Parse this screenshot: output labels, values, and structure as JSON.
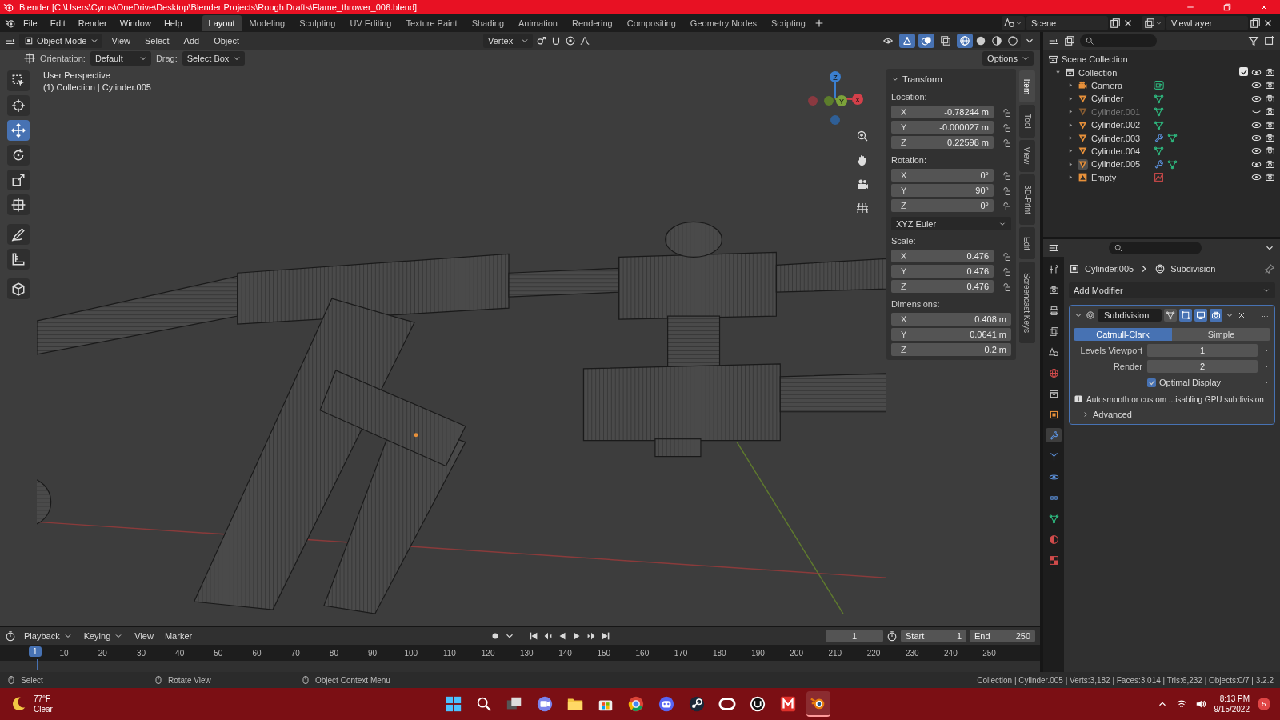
{
  "window": {
    "title": "Blender [C:\\Users\\Cyrus\\OneDrive\\Desktop\\Blender Projects\\Rough Drafts\\Flame_thrower_006.blend]"
  },
  "menu": [
    "File",
    "Edit",
    "Render",
    "Window",
    "Help"
  ],
  "workspaces": [
    {
      "label": "Layout",
      "selected": true
    },
    {
      "label": "Modeling",
      "selected": false
    },
    {
      "label": "Sculpting",
      "selected": false
    },
    {
      "label": "UV Editing",
      "selected": false
    },
    {
      "label": "Texture Paint",
      "selected": false
    },
    {
      "label": "Shading",
      "selected": false
    },
    {
      "label": "Animation",
      "selected": false
    },
    {
      "label": "Rendering",
      "selected": false
    },
    {
      "label": "Compositing",
      "selected": false
    },
    {
      "label": "Geometry Nodes",
      "selected": false
    },
    {
      "label": "Scripting",
      "selected": false
    }
  ],
  "scene": "Scene",
  "view_layer": "ViewLayer",
  "viewport_header": {
    "mode": "Object Mode",
    "menus": [
      "View",
      "Select",
      "Add",
      "Object"
    ],
    "snap_target": "Vertex",
    "toggles": [
      {
        "kind": "visibility",
        "on": false
      },
      {
        "kind": "gizmo",
        "on": true
      },
      {
        "kind": "overlays",
        "on": true
      },
      {
        "kind": "xray",
        "on": false
      }
    ],
    "shading": [
      {
        "kind": "wireframe",
        "selected": true
      },
      {
        "kind": "solid",
        "selected": false
      },
      {
        "kind": "material",
        "selected": false
      },
      {
        "kind": "rendered",
        "selected": false
      }
    ]
  },
  "tool_settings": {
    "orientation_label": "Orientation:",
    "orientation": "Default",
    "drag_label": "Drag:",
    "drag": "Select Box",
    "options": "Options"
  },
  "tools": [
    {
      "kind": "select",
      "selected": false
    },
    {
      "kind": "cursor",
      "selected": false
    },
    {
      "kind": "move",
      "selected": true
    },
    {
      "kind": "rotate",
      "selected": false
    },
    {
      "kind": "scale",
      "selected": false
    },
    {
      "kind": "transform",
      "selected": false
    },
    {
      "kind": "annotate",
      "selected": false
    },
    {
      "kind": "measure",
      "selected": false
    },
    {
      "kind": "add-cube",
      "selected": false
    }
  ],
  "viewport": {
    "view_name": "User Perspective",
    "context": "(1) Collection | Cylinder.005",
    "gizmo_axes": [
      "Z",
      "X",
      "Y"
    ]
  },
  "n_panel": {
    "title": "Transform",
    "groups": [
      {
        "label": "Location:",
        "kind": "lockable",
        "fields": [
          {
            "axis": "X",
            "value": "-0.78244 m"
          },
          {
            "axis": "Y",
            "value": "-0.000027 m"
          },
          {
            "axis": "Z",
            "value": "0.22598 m"
          }
        ]
      },
      {
        "label": "Rotation:",
        "kind": "lockable",
        "fields": [
          {
            "axis": "X",
            "value": "0°"
          },
          {
            "axis": "Y",
            "value": "90°"
          },
          {
            "axis": "Z",
            "value": "0°"
          }
        ],
        "mode": "XYZ Euler"
      },
      {
        "label": "Scale:",
        "kind": "lockable",
        "fields": [
          {
            "axis": "X",
            "value": "0.476"
          },
          {
            "axis": "Y",
            "value": "0.476"
          },
          {
            "axis": "Z",
            "value": "0.476"
          }
        ]
      },
      {
        "label": "Dimensions:",
        "kind": "plain",
        "fields": [
          {
            "axis": "X",
            "value": "0.408 m"
          },
          {
            "axis": "Y",
            "value": "0.0641 m"
          },
          {
            "axis": "Z",
            "value": "0.2 m"
          }
        ]
      }
    ],
    "tabs": [
      {
        "label": "Item",
        "selected": true
      },
      {
        "label": "Tool",
        "selected": false
      },
      {
        "label": "View",
        "selected": false
      },
      {
        "label": "3D-Print",
        "selected": false
      },
      {
        "label": "Edit",
        "selected": false
      },
      {
        "label": "Screencast Keys",
        "selected": false
      }
    ]
  },
  "outliner": {
    "root": "Scene Collection",
    "collections": [
      {
        "label": "Collection",
        "expanded": true,
        "checked": true,
        "children": [
          {
            "label": "Camera",
            "kind": "camera",
            "selected": false,
            "hidden": false,
            "modifier": false
          },
          {
            "label": "Cylinder",
            "kind": "mesh",
            "selected": false,
            "hidden": false,
            "modifier": false
          },
          {
            "label": "Cylinder.001",
            "kind": "mesh",
            "selected": false,
            "hidden": true,
            "modifier": false
          },
          {
            "label": "Cylinder.002",
            "kind": "mesh",
            "selected": false,
            "hidden": false,
            "modifier": false
          },
          {
            "label": "Cylinder.003",
            "kind": "mesh",
            "selected": false,
            "hidden": false,
            "modifier": true
          },
          {
            "label": "Cylinder.004",
            "kind": "mesh",
            "selected": false,
            "hidden": false,
            "modifier": false
          },
          {
            "label": "Cylinder.005",
            "kind": "mesh",
            "selected": true,
            "hidden": false,
            "modifier": true
          },
          {
            "label": "Empty",
            "kind": "empty",
            "selected": false,
            "hidden": false,
            "modifier": false
          }
        ]
      }
    ]
  },
  "properties": {
    "tabs": [
      {
        "kind": "tool",
        "selected": false
      },
      {
        "kind": "render",
        "selected": false
      },
      {
        "kind": "output",
        "selected": false
      },
      {
        "kind": "view-layer",
        "selected": false
      },
      {
        "kind": "scene",
        "selected": false
      },
      {
        "kind": "world",
        "selected": false
      },
      {
        "kind": "collection",
        "selected": false
      },
      {
        "kind": "object",
        "selected": false
      },
      {
        "kind": "modifier",
        "selected": true
      },
      {
        "kind": "particles",
        "selected": false
      },
      {
        "kind": "physics",
        "selected": false
      },
      {
        "kind": "constraints",
        "selected": false
      },
      {
        "kind": "data",
        "selected": false
      },
      {
        "kind": "material",
        "selected": false
      },
      {
        "kind": "texture",
        "selected": false
      }
    ],
    "object": "Cylinder.005",
    "modifier": "Subdivision",
    "add_modifier": "Add Modifier",
    "panel": {
      "name": "Subdivision",
      "expanded": true,
      "toggles": [
        {
          "kind": "on-cage",
          "on": false
        },
        {
          "kind": "edit-mode",
          "on": true
        },
        {
          "kind": "viewport",
          "on": true
        },
        {
          "kind": "render",
          "on": true
        }
      ],
      "methods": [
        {
          "label": "Catmull-Clark",
          "selected": true
        },
        {
          "label": "Simple",
          "selected": false
        }
      ],
      "fields": [
        {
          "label": "Levels Viewport",
          "value": "1"
        },
        {
          "label": "Render",
          "value": "2"
        }
      ],
      "optimal_display": {
        "label": "Optimal Display",
        "checked": true
      },
      "info": "Autosmooth or custom ...isabling GPU subdivision",
      "advanced": {
        "label": "Advanced",
        "expanded": false
      }
    }
  },
  "timeline": {
    "menus": [
      "Playback",
      "Keying",
      "View",
      "Marker"
    ],
    "current_frame": "1",
    "start_label": "Start",
    "start": "1",
    "end_label": "End",
    "end": "250",
    "playhead_frame": "1",
    "ruler": [
      "10",
      "20",
      "30",
      "40",
      "50",
      "60",
      "70",
      "80",
      "90",
      "100",
      "110",
      "120",
      "130",
      "140",
      "150",
      "160",
      "170",
      "180",
      "190",
      "200",
      "210",
      "220",
      "230",
      "240",
      "250"
    ]
  },
  "status_bar": {
    "hints": [
      "Select",
      "Rotate View",
      "Object Context Menu"
    ],
    "stats": "Collection | Cylinder.005 | Verts:3,182 | Faces:3,014 | Tris:6,232 | Objects:0/7 | 3.2.2"
  },
  "taskbar": {
    "temperature": "77°F",
    "weather": "Clear",
    "apps": [
      {
        "kind": "start",
        "selected": false
      },
      {
        "kind": "search",
        "selected": false
      },
      {
        "kind": "task-view",
        "selected": false
      },
      {
        "kind": "chat",
        "selected": false
      },
      {
        "kind": "folder",
        "selected": false
      },
      {
        "kind": "store",
        "selected": false
      },
      {
        "kind": "browser",
        "selected": false
      },
      {
        "kind": "gamepad",
        "selected": false
      },
      {
        "kind": "steam",
        "selected": false
      },
      {
        "kind": "ring",
        "selected": false
      },
      {
        "kind": "round-logo",
        "selected": false
      },
      {
        "kind": "m-logo",
        "selected": false
      },
      {
        "kind": "orbit-logo",
        "selected": true
      }
    ],
    "time": "8:13 PM",
    "date": "9/15/2022",
    "notifications": "5"
  }
}
